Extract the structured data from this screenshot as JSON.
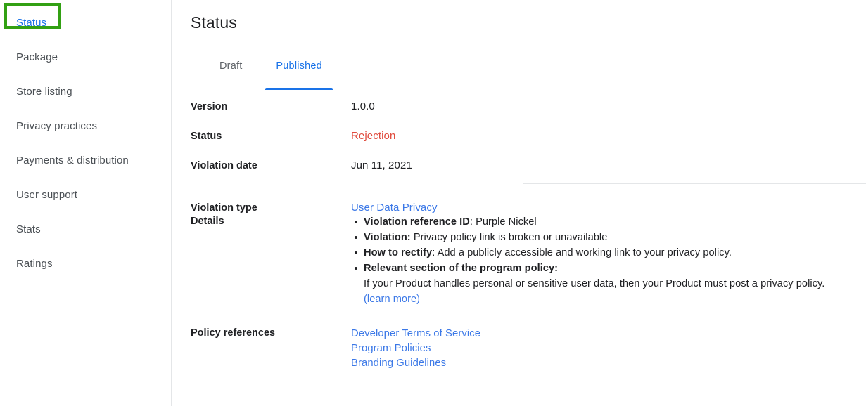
{
  "sidebar": {
    "items": [
      {
        "label": "Status",
        "active": true
      },
      {
        "label": "Package",
        "active": false
      },
      {
        "label": "Store listing",
        "active": false
      },
      {
        "label": "Privacy practices",
        "active": false
      },
      {
        "label": "Payments & distribution",
        "active": false
      },
      {
        "label": "User support",
        "active": false
      },
      {
        "label": "Stats",
        "active": false
      },
      {
        "label": "Ratings",
        "active": false
      }
    ],
    "highlight_color": "#32a013",
    "active_color": "#1a73e8"
  },
  "header": {
    "title": "Status"
  },
  "tabs": [
    {
      "label": "Draft",
      "selected": false
    },
    {
      "label": "Published",
      "selected": true
    }
  ],
  "details": {
    "version": {
      "label": "Version",
      "value": "1.0.0"
    },
    "status": {
      "label": "Status",
      "value": "Rejection",
      "color": "#e04a3c"
    },
    "violation_date": {
      "label": "Violation date",
      "value": "Jun 11, 2021"
    },
    "violation_type": {
      "label": "Violation type",
      "value": "User Data Privacy"
    },
    "details_label": "Details",
    "bullets": [
      {
        "bold": "Violation reference ID",
        "sep": ": ",
        "rest": "Purple Nickel"
      },
      {
        "bold": "Violation:",
        "sep": " ",
        "rest": "Privacy policy link is broken or unavailable"
      },
      {
        "bold": "How to rectify",
        "sep": ": ",
        "rest": "Add a publicly accessible and working link to your privacy policy."
      },
      {
        "bold": "Relevant section of the program policy:",
        "sep": "",
        "rest": ""
      }
    ],
    "policy_excerpt": "If your Product handles personal or sensitive user data, then your Product must post a privacy policy.",
    "learn_more": "(learn more)",
    "policy_references": {
      "label": "Policy references",
      "links": [
        "Developer Terms of Service",
        "Program Policies",
        "Branding Guidelines"
      ]
    }
  },
  "colors": {
    "link": "#3b78e7",
    "danger": "#e04a3c",
    "accent": "#1a73e8",
    "border": "#e4e6e8",
    "text": "#202124"
  }
}
